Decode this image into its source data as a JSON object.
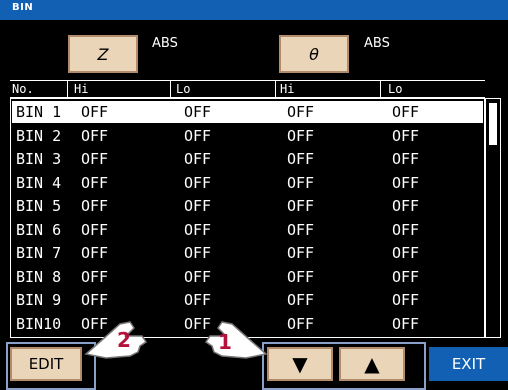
{
  "title": "BIN",
  "params": [
    {
      "label": "Z",
      "mode": "ABS"
    },
    {
      "label": "θ",
      "mode": "ABS"
    }
  ],
  "columns": {
    "no": "No.",
    "hi1": "Hi",
    "lo1": "Lo",
    "hi2": "Hi",
    "lo2": "Lo"
  },
  "rows": [
    {
      "name": "BIN 1",
      "z_hi": "OFF",
      "z_lo": "OFF",
      "t_hi": "OFF",
      "t_lo": "OFF"
    },
    {
      "name": "BIN 2",
      "z_hi": "OFF",
      "z_lo": "OFF",
      "t_hi": "OFF",
      "t_lo": "OFF"
    },
    {
      "name": "BIN 3",
      "z_hi": "OFF",
      "z_lo": "OFF",
      "t_hi": "OFF",
      "t_lo": "OFF"
    },
    {
      "name": "BIN 4",
      "z_hi": "OFF",
      "z_lo": "OFF",
      "t_hi": "OFF",
      "t_lo": "OFF"
    },
    {
      "name": "BIN 5",
      "z_hi": "OFF",
      "z_lo": "OFF",
      "t_hi": "OFF",
      "t_lo": "OFF"
    },
    {
      "name": "BIN 6",
      "z_hi": "OFF",
      "z_lo": "OFF",
      "t_hi": "OFF",
      "t_lo": "OFF"
    },
    {
      "name": "BIN 7",
      "z_hi": "OFF",
      "z_lo": "OFF",
      "t_hi": "OFF",
      "t_lo": "OFF"
    },
    {
      "name": "BIN 8",
      "z_hi": "OFF",
      "z_lo": "OFF",
      "t_hi": "OFF",
      "t_lo": "OFF"
    },
    {
      "name": "BIN 9",
      "z_hi": "OFF",
      "z_lo": "OFF",
      "t_hi": "OFF",
      "t_lo": "OFF"
    },
    {
      "name": "BIN10",
      "z_hi": "OFF",
      "z_lo": "OFF",
      "t_hi": "OFF",
      "t_lo": "OFF"
    }
  ],
  "selected_row": 0,
  "buttons": {
    "edit": "EDIT",
    "down": "▼",
    "up": "▲",
    "exit": "EXIT"
  },
  "callouts": [
    "2",
    "1"
  ],
  "colors": {
    "accent": "#1160b4",
    "button": "#ead5b8",
    "callout_number": "#b4123a"
  }
}
